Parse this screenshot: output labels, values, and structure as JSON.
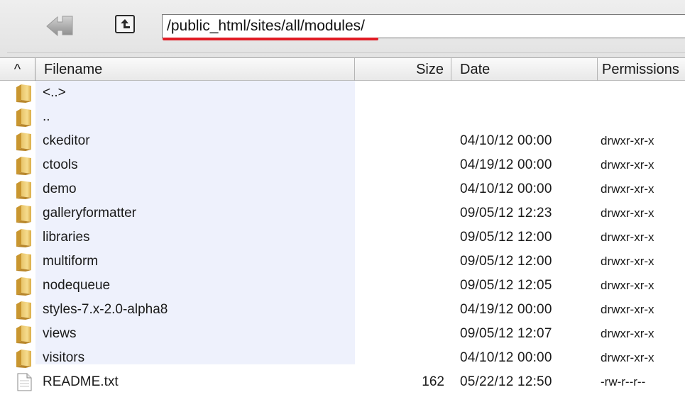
{
  "toolbar": {
    "path": "/public_html/sites/all/modules/",
    "back_icon": "back-arrow-icon",
    "up_icon": "folder-up-icon",
    "underline_color": "#e01b24"
  },
  "header": {
    "sort_glyph": "^",
    "filename": "Filename",
    "size": "Size",
    "date": "Date",
    "permissions": "Permissions"
  },
  "files": [
    {
      "name": "<..>",
      "size": "",
      "date": "",
      "perms": "",
      "type": "folder"
    },
    {
      "name": "..",
      "size": "",
      "date": "",
      "perms": "",
      "type": "folder"
    },
    {
      "name": "ckeditor",
      "size": "",
      "date": "04/10/12  00:00",
      "perms": "drwxr-xr-x",
      "type": "folder"
    },
    {
      "name": "ctools",
      "size": "",
      "date": "04/19/12  00:00",
      "perms": "drwxr-xr-x",
      "type": "folder"
    },
    {
      "name": "demo",
      "size": "",
      "date": "04/10/12  00:00",
      "perms": "drwxr-xr-x",
      "type": "folder"
    },
    {
      "name": "galleryformatter",
      "size": "",
      "date": "09/05/12  12:23",
      "perms": "drwxr-xr-x",
      "type": "folder"
    },
    {
      "name": "libraries",
      "size": "",
      "date": "09/05/12  12:00",
      "perms": "drwxr-xr-x",
      "type": "folder"
    },
    {
      "name": "multiform",
      "size": "",
      "date": "09/05/12  12:00",
      "perms": "drwxr-xr-x",
      "type": "folder"
    },
    {
      "name": "nodequeue",
      "size": "",
      "date": "09/05/12  12:05",
      "perms": "drwxr-xr-x",
      "type": "folder"
    },
    {
      "name": "styles-7.x-2.0-alpha8",
      "size": "",
      "date": "04/19/12  00:00",
      "perms": "drwxr-xr-x",
      "type": "folder"
    },
    {
      "name": "views",
      "size": "",
      "date": "09/05/12  12:07",
      "perms": "drwxr-xr-x",
      "type": "folder"
    },
    {
      "name": "visitors",
      "size": "",
      "date": "04/10/12  00:00",
      "perms": "drwxr-xr-x",
      "type": "folder"
    },
    {
      "name": "README.txt",
      "size": "162",
      "date": "05/22/12  12:50",
      "perms": "-rw-r--r--",
      "type": "file"
    }
  ],
  "icons": {
    "folder": "folder-icon",
    "file": "text-file-icon"
  }
}
